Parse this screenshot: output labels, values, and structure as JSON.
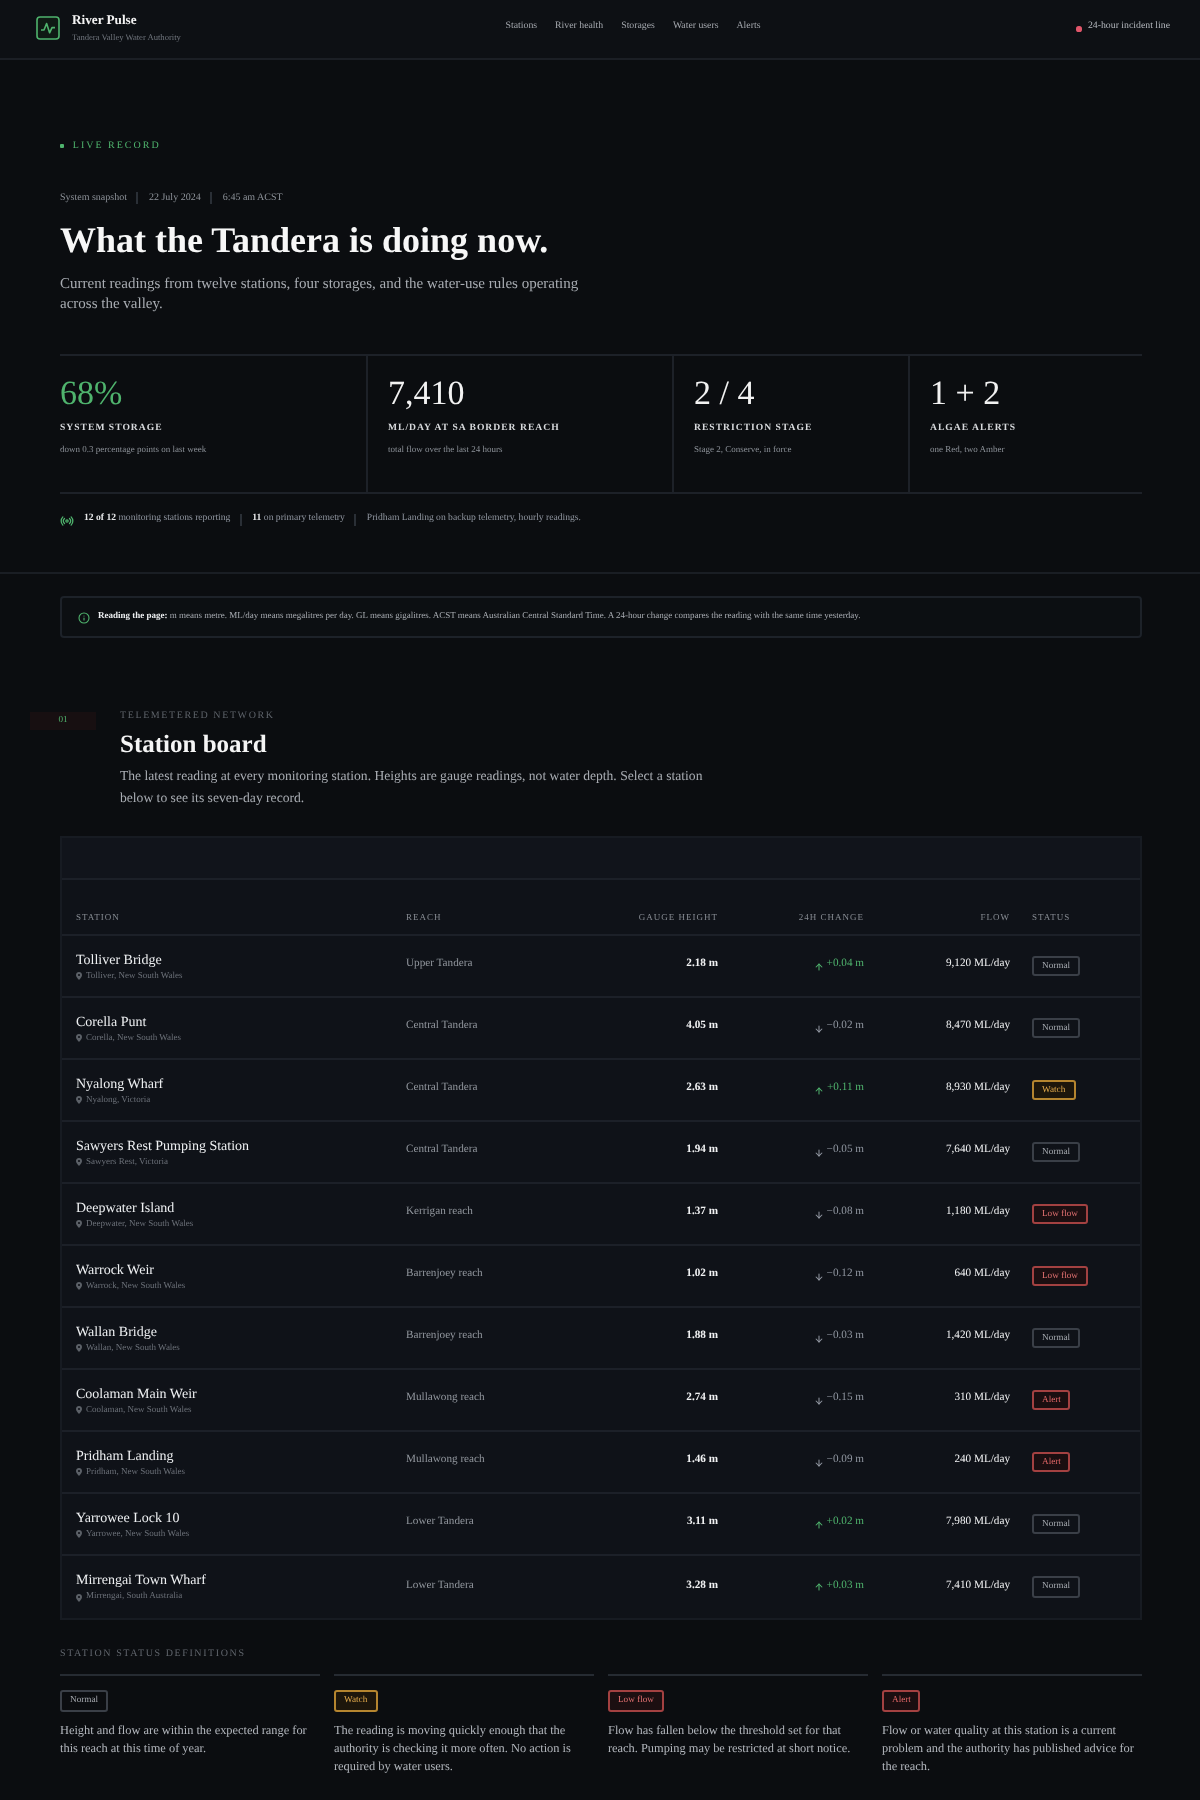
{
  "header": {
    "brand": {
      "name": "River Pulse",
      "tagline": "Tandera Valley Water Authority"
    },
    "nav": [
      {
        "label": "Stations"
      },
      {
        "label": "River health"
      },
      {
        "label": "Storages"
      },
      {
        "label": "Water users"
      },
      {
        "label": "Alerts"
      }
    ],
    "incident_line": "24-hour incident line"
  },
  "hero": {
    "eyebrow": "LIVE RECORD",
    "meta": [
      "System snapshot",
      "22 July 2024",
      "6:45 am ACST"
    ],
    "title": "What the Tandera is doing now.",
    "lede": "Current readings from twelve stations, four storages, and the water-use rules operating across the valley."
  },
  "stats": [
    {
      "value": "68%",
      "label": "SYSTEM STORAGE",
      "note": "down 0.3 percentage points on last week",
      "highlight": true
    },
    {
      "value": "7,410",
      "label": "ML/DAY AT SA BORDER REACH",
      "note": "total flow over the last 24 hours",
      "highlight": false
    },
    {
      "value": "2 / 4",
      "label": "RESTRICTION STAGE",
      "note": "Stage 2, Conserve, in force",
      "highlight": false
    },
    {
      "value": "1 + 2",
      "label": "ALGAE ALERTS",
      "note": "one Red, two Amber",
      "highlight": false
    }
  ],
  "telemetry": [
    "**12 of 12** monitoring stations reporting",
    "**11** on primary telemetry",
    "Pridham Landing on backup telemetry, hourly readings."
  ],
  "notice": "**Reading the page:** m means metre. ML/day means megalitres per day. GL means gigalitres. ACST means Australian Central Standard Time. A 24-hour change compares the reading with the same time yesterday.",
  "section": {
    "number": "01",
    "eyebrow": "TELEMETERED NETWORK",
    "title": "Station board",
    "description": "The latest reading at every monitoring station. Heights are gauge readings, not water depth. Select a station below to see its seven-day record."
  },
  "table": {
    "columns": [
      "STATION",
      "REACH",
      "GAUGE HEIGHT",
      "24H CHANGE",
      "FLOW",
      "STATUS"
    ],
    "rows": [
      {
        "station": "Tolliver Bridge",
        "location": "Tolliver, New South Wales",
        "reach": "Upper Tandera",
        "gauge_height": "2.18 m",
        "change": {
          "rising": true,
          "text": "+0.04 m"
        },
        "flow": "9,120 ML/day",
        "status": {
          "kind": "normal",
          "label": "Normal"
        }
      },
      {
        "station": "Corella Punt",
        "location": "Corella, New South Wales",
        "reach": "Central Tandera",
        "gauge_height": "4.05 m",
        "change": {
          "rising": false,
          "text": "−0.02 m"
        },
        "flow": "8,470 ML/day",
        "status": {
          "kind": "normal",
          "label": "Normal"
        }
      },
      {
        "station": "Nyalong Wharf",
        "location": "Nyalong, Victoria",
        "reach": "Central Tandera",
        "gauge_height": "2.63 m",
        "change": {
          "rising": true,
          "text": "+0.11 m"
        },
        "flow": "8,930 ML/day",
        "status": {
          "kind": "watch",
          "label": "Watch"
        }
      },
      {
        "station": "Sawyers Rest Pumping Station",
        "location": "Sawyers Rest, Victoria",
        "reach": "Central Tandera",
        "gauge_height": "1.94 m",
        "change": {
          "rising": false,
          "text": "−0.05 m"
        },
        "flow": "7,640 ML/day",
        "status": {
          "kind": "normal",
          "label": "Normal"
        }
      },
      {
        "station": "Deepwater Island",
        "location": "Deepwater, New South Wales",
        "reach": "Kerrigan reach",
        "gauge_height": "1.37 m",
        "change": {
          "rising": false,
          "text": "−0.08 m"
        },
        "flow": "1,180 ML/day",
        "status": {
          "kind": "low_flow",
          "label": "Low flow"
        }
      },
      {
        "station": "Warrock Weir",
        "location": "Warrock, New South Wales",
        "reach": "Barrenjoey reach",
        "gauge_height": "1.02 m",
        "change": {
          "rising": false,
          "text": "−0.12 m"
        },
        "flow": "640 ML/day",
        "status": {
          "kind": "low_flow",
          "label": "Low flow"
        }
      },
      {
        "station": "Wallan Bridge",
        "location": "Wallan, New South Wales",
        "reach": "Barrenjoey reach",
        "gauge_height": "1.88 m",
        "change": {
          "rising": false,
          "text": "−0.03 m"
        },
        "flow": "1,420 ML/day",
        "status": {
          "kind": "normal",
          "label": "Normal"
        }
      },
      {
        "station": "Coolaman Main Weir",
        "location": "Coolaman, New South Wales",
        "reach": "Mullawong reach",
        "gauge_height": "2.74 m",
        "change": {
          "rising": false,
          "text": "−0.15 m"
        },
        "flow": "310 ML/day",
        "status": {
          "kind": "alert",
          "label": "Alert"
        }
      },
      {
        "station": "Pridham Landing",
        "location": "Pridham, New South Wales",
        "reach": "Mullawong reach",
        "gauge_height": "1.46 m",
        "change": {
          "rising": false,
          "text": "−0.09 m"
        },
        "flow": "240 ML/day",
        "status": {
          "kind": "alert",
          "label": "Alert"
        }
      },
      {
        "station": "Yarrowee Lock 10",
        "location": "Yarrowee, New South Wales",
        "reach": "Lower Tandera",
        "gauge_height": "3.11 m",
        "change": {
          "rising": true,
          "text": "+0.02 m"
        },
        "flow": "7,980 ML/day",
        "status": {
          "kind": "normal",
          "label": "Normal"
        }
      },
      {
        "station": "Mirrengai Town Wharf",
        "location": "Mirrengai, South Australia",
        "reach": "Lower Tandera",
        "gauge_height": "3.28 m",
        "change": {
          "rising": true,
          "text": "+0.03 m"
        },
        "flow": "7,410 ML/day",
        "status": {
          "kind": "normal",
          "label": "Normal"
        }
      }
    ]
  },
  "definitions": {
    "title": "STATION STATUS DEFINITIONS",
    "items": [
      {
        "status": {
          "kind": "normal",
          "label": "Normal"
        },
        "text": "Height and flow are within the expected range for this reach at this time of year."
      },
      {
        "status": {
          "kind": "watch",
          "label": "Watch"
        },
        "text": "The reading is moving quickly enough that the authority is checking it more often. No action is required by water users."
      },
      {
        "status": {
          "kind": "low_flow",
          "label": "Low flow"
        },
        "text": "Flow has fallen below the threshold set for that reach. Pumping may be restricted at short notice."
      },
      {
        "status": {
          "kind": "alert",
          "label": "Alert"
        },
        "text": "Flow or water quality at this station is a current problem and the authority has published advice for the reach."
      }
    ]
  }
}
